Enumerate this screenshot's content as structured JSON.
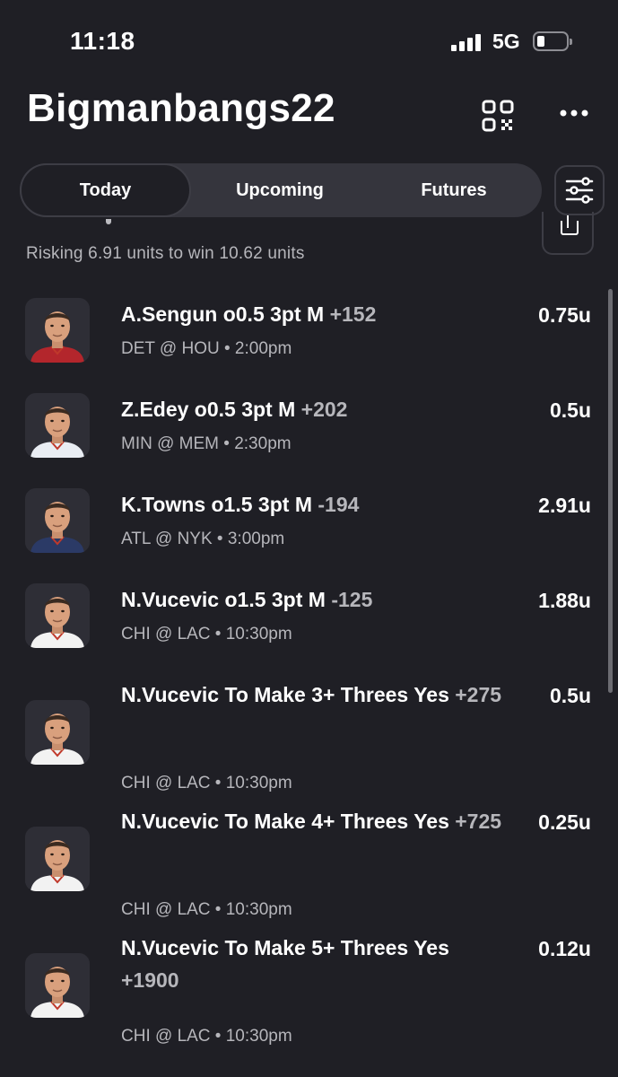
{
  "status_bar": {
    "time": "11:18",
    "network": "5G",
    "battery_level": 0.25
  },
  "header": {
    "title": "Bigmanbangs22",
    "qr_icon": "qr-code-icon",
    "more_icon": "more-horizontal-icon"
  },
  "tabs": [
    {
      "label": "Today",
      "active": true
    },
    {
      "label": "Upcoming",
      "active": false
    },
    {
      "label": "Futures",
      "active": false
    }
  ],
  "filter_icon": "sliders-icon",
  "summary": "Risking 6.91 units to win 10.62 units",
  "bets": [
    {
      "title": "A.Sengun o0.5 3pt M",
      "odds": "+152",
      "meta": "DET @ HOU • 2:00pm",
      "units": "0.75u",
      "jersey": "#b3262c"
    },
    {
      "title": "Z.Edey o0.5 3pt M",
      "odds": "+202",
      "meta": "MIN @ MEM • 2:30pm",
      "units": "0.5u",
      "jersey": "#e9edf3"
    },
    {
      "title": "K.Towns o1.5 3pt M",
      "odds": "-194",
      "meta": "ATL @ NYK • 3:00pm",
      "units": "2.91u",
      "jersey": "#2b3a66"
    },
    {
      "title": "N.Vucevic o1.5 3pt M",
      "odds": "-125",
      "meta": "CHI @ LAC • 10:30pm",
      "units": "1.88u",
      "jersey": "#f2f2f2"
    },
    {
      "title": "N.Vucevic To Make 3+ Threes Yes",
      "odds": "+275",
      "meta": "CHI @ LAC • 10:30pm",
      "units": "0.5u",
      "jersey": "#f2f2f2"
    },
    {
      "title": "N.Vucevic To Make 4+ Threes Yes",
      "odds": "+725",
      "meta": "CHI @ LAC • 10:30pm",
      "units": "0.25u",
      "jersey": "#f2f2f2"
    },
    {
      "title": "N.Vucevic To Make 5+ Threes Yes",
      "odds": "+1900",
      "meta": "CHI @ LAC • 10:30pm",
      "units": "0.12u",
      "jersey": "#f2f2f2"
    }
  ]
}
